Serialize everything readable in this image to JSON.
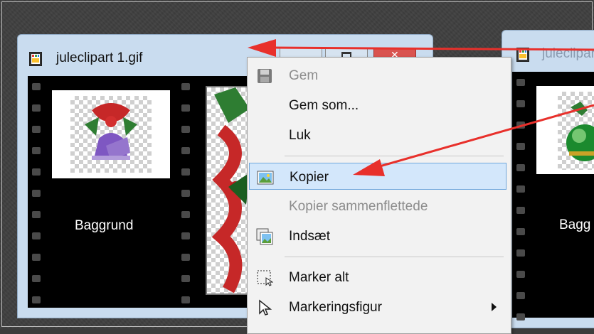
{
  "left_window": {
    "title": "juleclipart 1.gif",
    "layer_label": "Baggrund",
    "icon": "image-file-icon"
  },
  "right_window": {
    "title": "juleclipart",
    "layer_label": "Bagg",
    "icon": "image-file-icon"
  },
  "context_menu": {
    "items": [
      {
        "label": "Gem",
        "disabled": true,
        "icon": "save-icon"
      },
      {
        "label": "Gem som...",
        "disabled": false
      },
      {
        "label": "Luk",
        "disabled": false
      },
      {
        "label": "Kopier",
        "disabled": false,
        "highlighted": true,
        "icon": "copy-image-icon"
      },
      {
        "label": "Kopier sammenflettede",
        "disabled": true
      },
      {
        "label": "Indsæt",
        "disabled": false,
        "icon": "paste-image-icon"
      },
      {
        "label": "Marker alt",
        "disabled": false,
        "icon": "select-all-icon"
      },
      {
        "label": "Markeringsfigur",
        "disabled": false,
        "icon": "selection-cursor-icon",
        "submenu": true
      }
    ]
  },
  "colors": {
    "highlight": "#d3e7fb",
    "highlight_border": "#6fa7dc",
    "annotation_arrow": "#e8302b",
    "close_button": "#d9534f"
  }
}
